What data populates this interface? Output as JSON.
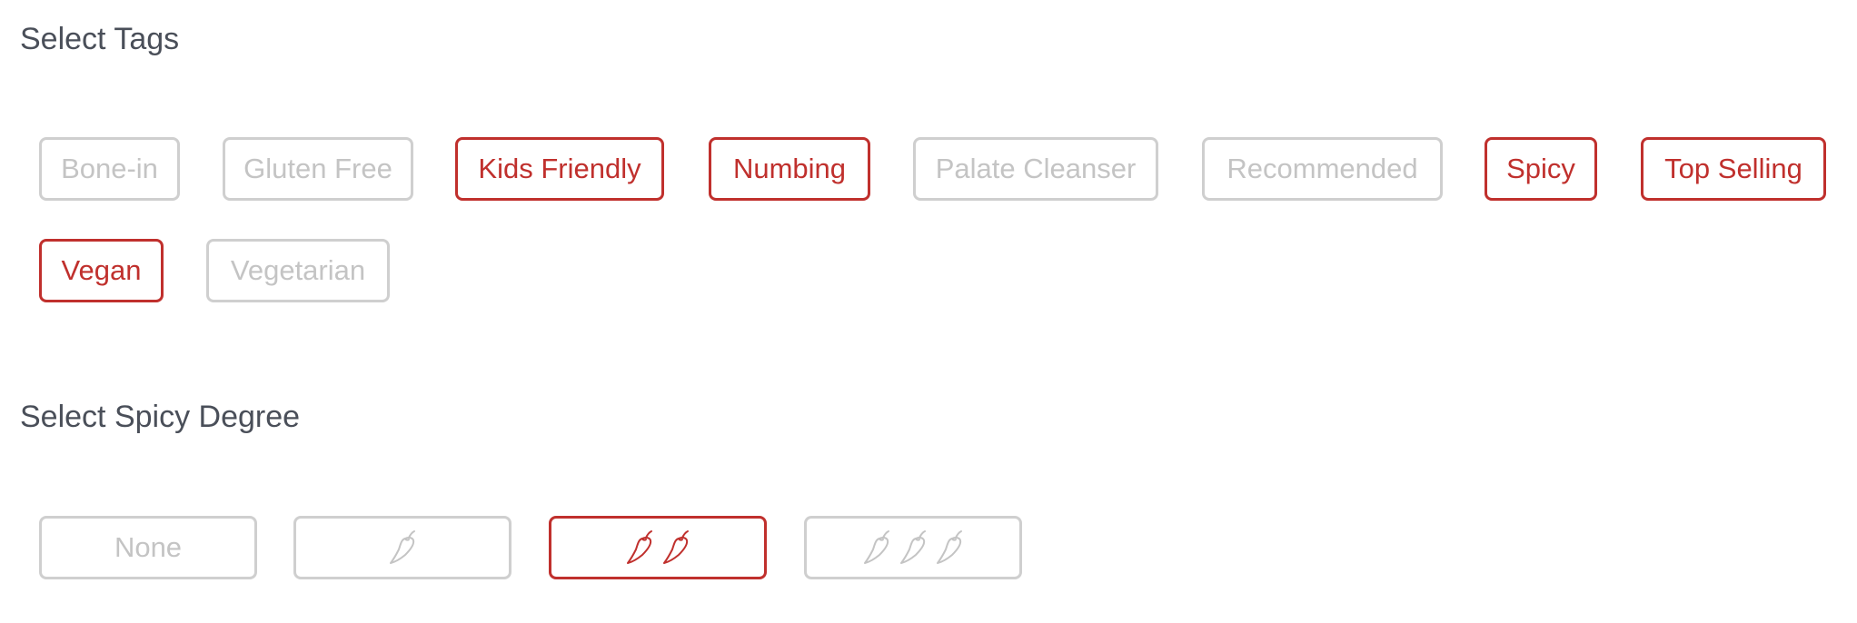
{
  "tags_section": {
    "title": "Select Tags",
    "tags": [
      {
        "label": "Bone-in",
        "selected": false
      },
      {
        "label": "Gluten Free",
        "selected": false
      },
      {
        "label": "Kids Friendly",
        "selected": true
      },
      {
        "label": "Numbing",
        "selected": true
      },
      {
        "label": "Palate Cleanser",
        "selected": false
      },
      {
        "label": "Recommended",
        "selected": false
      },
      {
        "label": "Spicy",
        "selected": true
      },
      {
        "label": "Top Selling",
        "selected": true
      },
      {
        "label": "Vegan",
        "selected": true
      },
      {
        "label": "Vegetarian",
        "selected": false
      }
    ]
  },
  "spicy_section": {
    "title": "Select Spicy Degree",
    "options": [
      {
        "label": "None",
        "peppers": 0,
        "selected": false
      },
      {
        "label": "",
        "peppers": 1,
        "selected": false
      },
      {
        "label": "",
        "peppers": 2,
        "selected": true
      },
      {
        "label": "",
        "peppers": 3,
        "selected": false
      }
    ],
    "icon": "chili-pepper-icon"
  },
  "colors": {
    "accent": "#c0302d",
    "inactive_border": "#cfcfcf",
    "inactive_text": "#c4c4c4",
    "heading": "#4a4f59"
  }
}
